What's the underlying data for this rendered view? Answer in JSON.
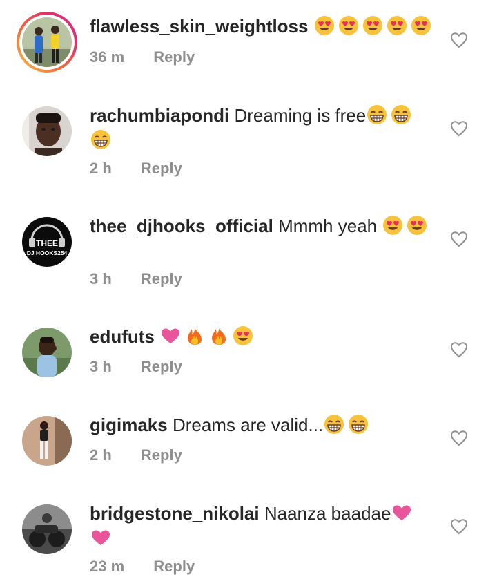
{
  "comments": [
    {
      "username": "flawless_skin_weightloss",
      "text": "",
      "emojis": [
        "heart-eyes",
        "heart-eyes",
        "heart-eyes",
        "heart-eyes",
        "heart-eyes"
      ],
      "time": "36 m",
      "reply_label": "Reply",
      "has_story_ring": true
    },
    {
      "username": "rachumbiapondi",
      "text": "Dreaming is free",
      "emojis": [
        "grin",
        "grin",
        "grin"
      ],
      "time": "2 h",
      "reply_label": "Reply"
    },
    {
      "username": "thee_djhooks_official",
      "text": "Mmmh yeah",
      "emojis": [
        "heart-eyes",
        "heart-eyes"
      ],
      "time": "3 h",
      "reply_label": "Reply",
      "avatar_text_top": "THEE",
      "avatar_text_bottom": "DJ HOOKS254"
    },
    {
      "username": "edufuts",
      "text": "",
      "emojis": [
        "pink-heart",
        "fire",
        "fire",
        "heart-eyes"
      ],
      "time": "3 h",
      "reply_label": "Reply"
    },
    {
      "username": "gigimaks",
      "text": "Dreams are valid...",
      "emojis": [
        "grin",
        "grin"
      ],
      "time": "2 h",
      "reply_label": "Reply"
    },
    {
      "username": "bridgestone_nikolai",
      "text": "Naanza baadae",
      "emojis": [
        "pink-heart",
        "pink-heart"
      ],
      "time": "23 m",
      "reply_label": "Reply"
    }
  ],
  "icons": {
    "like": "heart-outline-icon"
  },
  "colors": {
    "text": "#262626",
    "muted": "#8e8e8e",
    "like_outline": "#8e8e8e",
    "emoji_face": "#f7c33b",
    "emoji_heart": "#e8315a",
    "pink_heart": "#e8559a",
    "fire": "#f26c1a"
  }
}
